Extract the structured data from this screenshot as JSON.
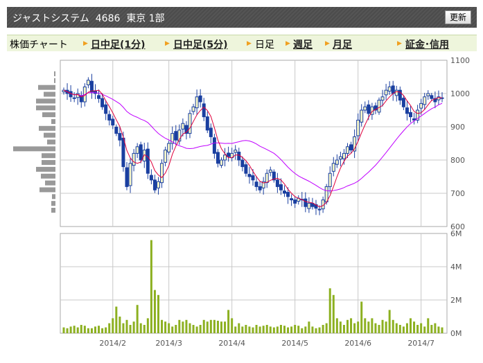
{
  "header": {
    "title": "ジャストシステム  4686  東京 1部",
    "refresh_label": "更新"
  },
  "nav": {
    "label": "株価チャート",
    "links": [
      "日中足(1分)",
      "日中足(5分)",
      "日足",
      "週足",
      "月足",
      "証金･信用"
    ],
    "current": "日足"
  },
  "colors": {
    "up_fill": "#f6f6c8",
    "candle": "#1a3fa0",
    "ma_short": "#e0003c",
    "ma_long": "#c000ff",
    "volume": "#8cb020",
    "histogram": "#999999",
    "grid": "#c8c8c8"
  },
  "chart_data": {
    "type": "candlestick",
    "price_axis": {
      "ticks": [
        "1100",
        "1000",
        "900",
        "800",
        "700",
        "600"
      ],
      "ylim": [
        600,
        1100
      ]
    },
    "volume_axis": {
      "ticks": [
        "6M",
        "4M",
        "2M",
        "0M"
      ],
      "ylim": [
        0,
        6
      ]
    },
    "x_ticks": [
      {
        "label": "2014/2",
        "index": 14
      },
      {
        "label": "2014/3",
        "index": 30
      },
      {
        "label": "2014/4",
        "index": 48
      },
      {
        "label": "2014/5",
        "index": 66
      },
      {
        "label": "2014/6",
        "index": 84
      },
      {
        "label": "2014/7",
        "index": 102
      }
    ],
    "close": [
      1010,
      1000,
      990,
      985,
      1000,
      975,
      1020,
      1040,
      1005,
      1000,
      985,
      960,
      940,
      920,
      905,
      880,
      860,
      780,
      720,
      790,
      820,
      840,
      800,
      830,
      760,
      740,
      710,
      735,
      790,
      830,
      850,
      880,
      860,
      890,
      910,
      880,
      940,
      960,
      990,
      975,
      930,
      890,
      870,
      820,
      790,
      800,
      815,
      810,
      820,
      830,
      800,
      780,
      760,
      750,
      740,
      720,
      710,
      735,
      760,
      770,
      740,
      720,
      710,
      700,
      690,
      680,
      670,
      685,
      680,
      660,
      670,
      660,
      655,
      650,
      680,
      720,
      760,
      790,
      800,
      810,
      820,
      840,
      830,
      870,
      920,
      950,
      960,
      940,
      960,
      950,
      980,
      990,
      1010,
      1020,
      1000,
      1010,
      980,
      960,
      940,
      930,
      920,
      950,
      970,
      990,
      1000,
      985,
      975,
      990,
      985
    ],
    "volume_m": [
      0.35,
      0.3,
      0.4,
      0.45,
      0.35,
      0.5,
      0.45,
      0.3,
      0.3,
      0.4,
      0.45,
      0.3,
      0.35,
      0.6,
      0.9,
      1.6,
      1.0,
      0.6,
      0.8,
      0.5,
      0.7,
      1.7,
      0.6,
      0.5,
      0.9,
      5.6,
      2.6,
      2.3,
      0.8,
      0.7,
      0.6,
      0.4,
      0.5,
      0.8,
      0.7,
      0.8,
      0.6,
      0.5,
      0.4,
      0.5,
      0.8,
      0.7,
      0.8,
      0.8,
      0.75,
      0.7,
      0.7,
      1.4,
      0.9,
      0.4,
      0.6,
      0.4,
      0.5,
      0.4,
      0.35,
      0.5,
      0.4,
      0.45,
      0.5,
      0.4,
      0.35,
      0.4,
      0.5,
      0.45,
      0.35,
      0.4,
      0.5,
      0.45,
      0.3,
      0.4,
      0.7,
      0.4,
      0.3,
      0.35,
      0.5,
      0.6,
      2.7,
      2.3,
      0.9,
      0.7,
      0.5,
      0.8,
      0.9,
      0.6,
      0.7,
      1.9,
      0.9,
      0.7,
      0.9,
      0.6,
      0.5,
      0.8,
      0.7,
      1.4,
      0.8,
      0.6,
      0.5,
      0.4,
      0.6,
      0.9,
      0.7,
      0.5,
      0.6,
      0.4,
      0.9,
      0.5,
      0.6,
      0.4,
      0.35
    ],
    "price_volume_profile": [
      2,
      2,
      25,
      17,
      28,
      28,
      19,
      6,
      24,
      17,
      12,
      61,
      20,
      20,
      28,
      21,
      15,
      23,
      5,
      6,
      6
    ],
    "ma_short_period": 5,
    "ma_long_period": 25
  }
}
